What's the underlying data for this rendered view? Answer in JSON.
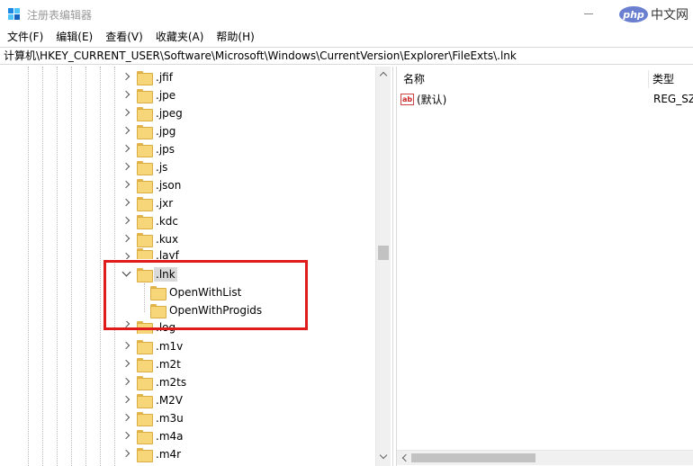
{
  "window": {
    "title": "注册表编辑器",
    "watermark_logo": "php",
    "watermark_text": "中文网"
  },
  "menu": [
    "文件(F)",
    "编辑(E)",
    "查看(V)",
    "收藏夹(A)",
    "帮助(H)"
  ],
  "address": "计算机\\HKEY_CURRENT_USER\\Software\\Microsoft\\Windows\\CurrentVersion\\Explorer\\FileExts\\.lnk",
  "tree": {
    "items_before": [
      ".jfif",
      ".jpe",
      ".jpeg",
      ".jpg",
      ".jps",
      ".js",
      ".json",
      ".jxr",
      ".kdc",
      ".kux",
      ".layf"
    ],
    "selected": ".lnk",
    "children": [
      "OpenWithList",
      "OpenWithProgids"
    ],
    "items_after": [
      ".log",
      ".m1v",
      ".m2t",
      ".m2ts",
      ".M2V",
      ".m3u",
      ".m4a",
      ".m4r"
    ]
  },
  "values": {
    "columns": [
      "名称",
      "类型"
    ],
    "rows": [
      {
        "icon": "ab",
        "name": "(默认)",
        "type": "REG_SZ"
      }
    ]
  },
  "colors": {
    "highlight_border": "#e01b1b",
    "folder": "#f7d67a",
    "selection": "#d9d9d9"
  }
}
